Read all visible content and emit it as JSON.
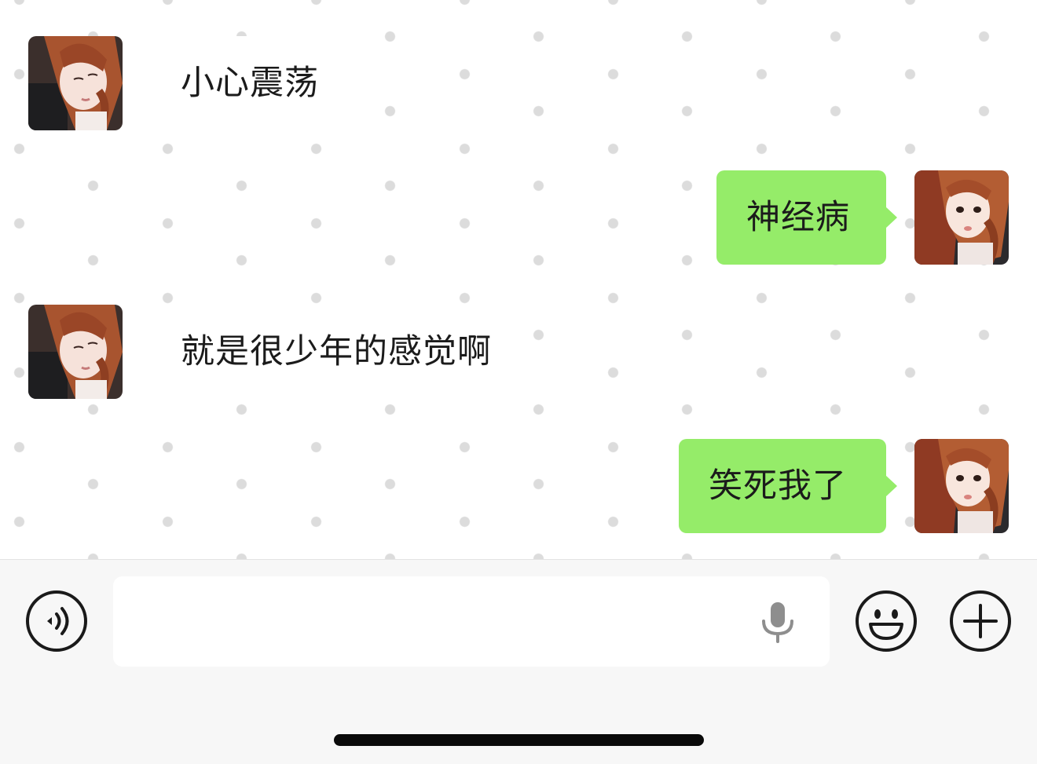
{
  "messages": [
    {
      "direction": "incoming",
      "text": "小心震荡",
      "avatar": "girl-avatar"
    },
    {
      "direction": "outgoing",
      "text": "神经病",
      "avatar": "girl-avatar"
    },
    {
      "direction": "incoming",
      "text": "就是很少年的感觉啊",
      "avatar": "girl-avatar"
    },
    {
      "direction": "outgoing",
      "text": "笑死我了",
      "avatar": "girl-avatar"
    }
  ],
  "composer": {
    "placeholder": "",
    "value": "",
    "voice_icon": "voice-icon",
    "mic_icon": "microphone-icon",
    "emoji_icon": "emoji-icon",
    "plus_icon": "plus-icon"
  },
  "colors": {
    "outgoing_bubble": "#95ec69",
    "incoming_bubble": "#ffffff",
    "background_dot": "#dcdcdc",
    "input_bar": "#f7f7f7"
  }
}
